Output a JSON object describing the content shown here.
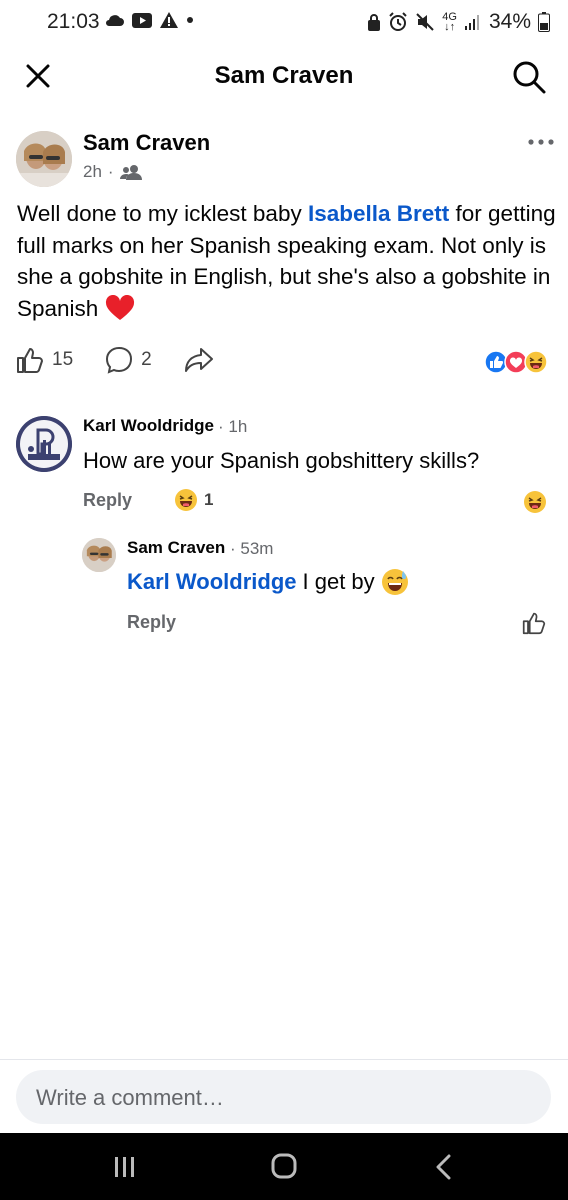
{
  "status_bar": {
    "time": "21:03",
    "network": "4G",
    "battery": "34%"
  },
  "header": {
    "title": "Sam Craven"
  },
  "post": {
    "author": "Sam Craven",
    "time": "2h",
    "audience_icon": "friends-icon",
    "text_before": "Well done to my icklest baby ",
    "mention": "Isabella Brett",
    "text_after": " for getting full marks on her Spanish speaking exam. Not only is she a gobshite in English, but she's also a gobshite in Spanish",
    "like_count": "15",
    "comment_count": "2",
    "reactions": [
      "like",
      "love",
      "haha"
    ]
  },
  "comments": [
    {
      "author": "Karl Wooldridge",
      "time": "1h",
      "text": "How are your Spanish gobshittery skills?",
      "reply_label": "Reply",
      "reaction_count": "1"
    }
  ],
  "reply": {
    "author": "Sam Craven",
    "time": "53m",
    "mention": "Karl Wooldridge",
    "text": "I get by",
    "reply_label": "Reply"
  },
  "composer": {
    "placeholder": "Write a comment…"
  },
  "colors": {
    "mention": "#0a58ca",
    "like_blue": "#1877f2",
    "love_red": "#f33e58",
    "meta_gray": "#65676b"
  }
}
